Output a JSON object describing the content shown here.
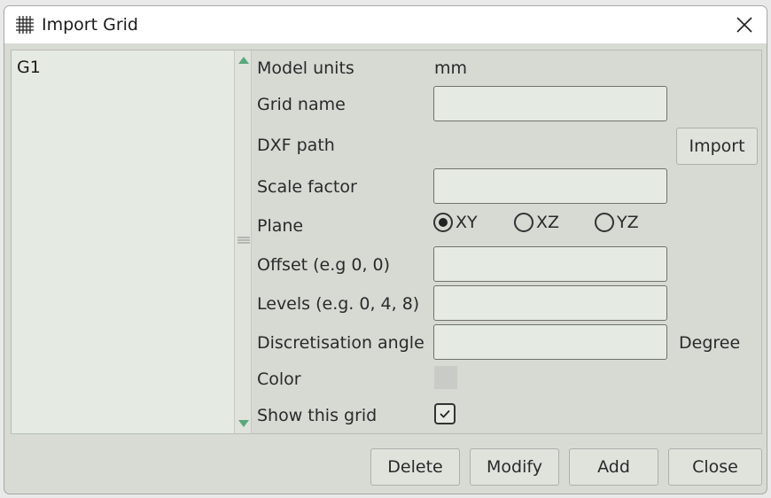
{
  "window": {
    "title": "Import Grid"
  },
  "list": {
    "items": [
      "G1"
    ]
  },
  "form": {
    "model_units_label": "Model units",
    "model_units_value": "mm",
    "grid_name_label": "Grid name",
    "grid_name_value": "",
    "dxf_path_label": "DXF path",
    "import_button": "Import",
    "scale_factor_label": "Scale factor",
    "scale_factor_value": "",
    "plane_label": "Plane",
    "plane_options": [
      "XY",
      "XZ",
      "YZ"
    ],
    "plane_selected": "XY",
    "offset_label": "Offset (e.g 0, 0)",
    "offset_value": "",
    "levels_label": "Levels (e.g. 0, 4, 8)",
    "levels_value": "",
    "discretisation_label": "Discretisation angle",
    "discretisation_value": "",
    "discretisation_unit": "Degree",
    "color_label": "Color",
    "color_value": "#c8cbc6",
    "show_grid_label": "Show this grid",
    "show_grid_checked": true
  },
  "buttons": {
    "delete": "Delete",
    "modify": "Modify",
    "add": "Add",
    "close": "Close"
  },
  "icons": {
    "title": "grid-icon",
    "close": "close-icon",
    "scroll_up": "arrow-up-icon",
    "scroll_down": "arrow-down-icon",
    "check": "checkmark-icon"
  }
}
